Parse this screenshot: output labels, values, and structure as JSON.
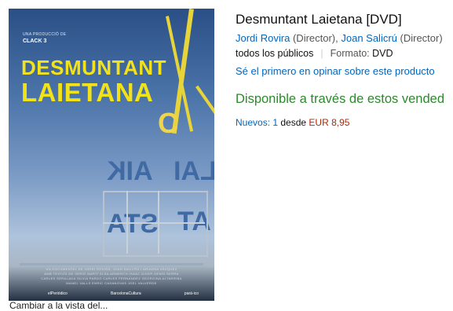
{
  "product": {
    "title": "Desmuntant Laietana [DVD]",
    "authors": [
      {
        "name": "Jordi Rovira",
        "role": " (Director), "
      },
      {
        "name": "Joan Salicrú",
        "role": " (Director)"
      }
    ],
    "audience": "todos los públicos",
    "format_label": "Formato: ",
    "format_value": "DVD",
    "review_prompt": "Sé el primero en opinar sobre este producto",
    "availability_prefix": "Disponible a través de ",
    "availability_link": "estos vended",
    "offers_label": "Nuevos: ",
    "offers_count": "1",
    "offers_from": " desde ",
    "offers_price": "EUR 8,95"
  },
  "cover": {
    "producer_line": "UNA PRODUCCIÓ DE",
    "producer_logo": "CLACK  3",
    "title_line1": "DESMUNTANT",
    "title_line2": "LAIETANA",
    "credits_lines": [
      "UN DOCUMENTAL DE JORDI ROVIRA, JOAN SALICRÚ I ARIADNA VÁZQUEZ",
      "AMB TEXTOS DE SERGI MARTÍ  ELSA ARMERCH  ISAAC GIVER  GENÍS SERRA",
      "CARLES SERALADA  SILVIA PARDO  CARLES FERNÁNDEZ  GEORGINA ALTARRIBA",
      "MANEL VALLS  ENRIC CASANOVAS  JOEL VALVERDE"
    ],
    "logos": [
      "elPeriódico",
      "BarcelonaCultura",
      "pará-ico"
    ]
  },
  "caption": "Cambiar a la vista del..."
}
